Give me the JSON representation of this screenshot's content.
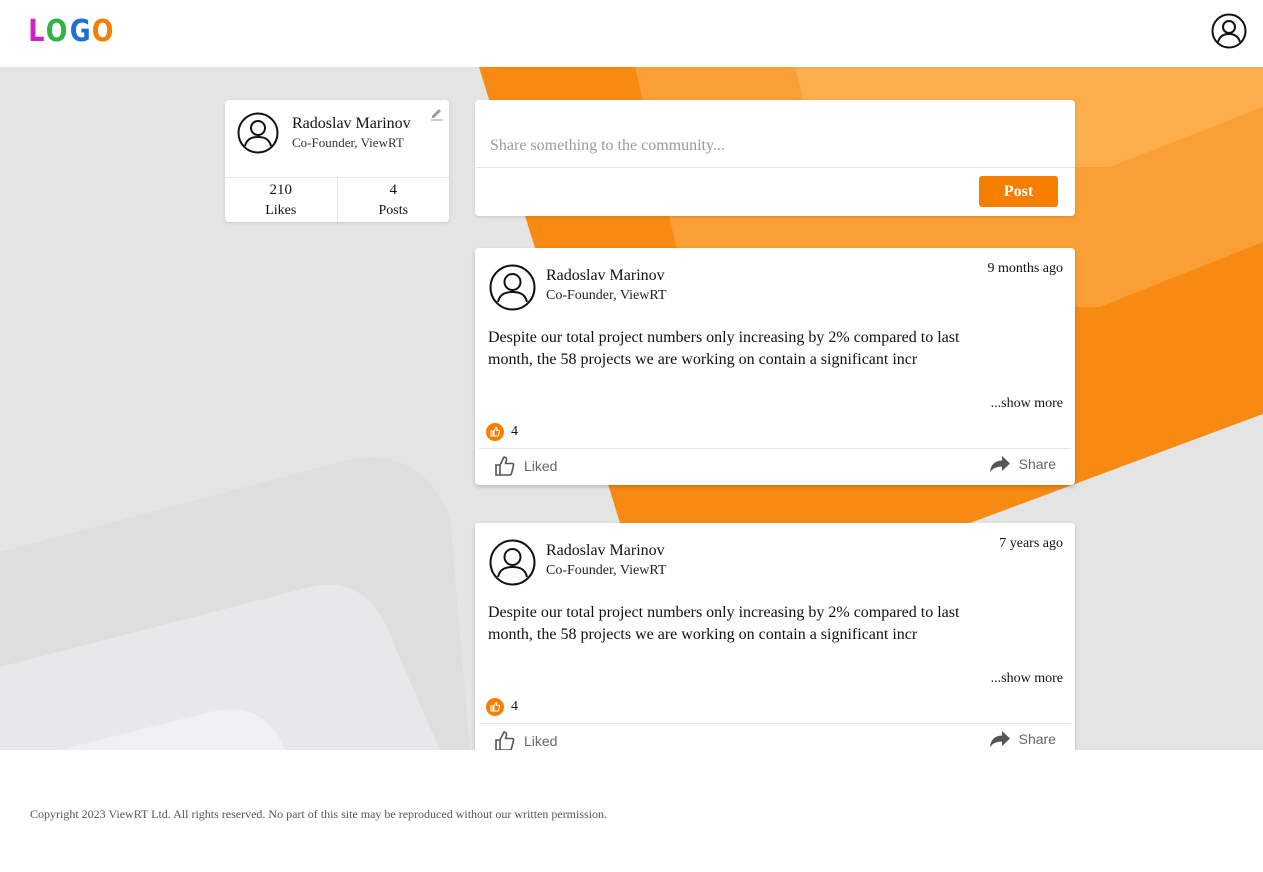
{
  "header": {
    "logo_letters": [
      "L",
      "O",
      "G",
      "O"
    ],
    "logo_colors": [
      "#d61ec8",
      "#2fb344",
      "#1f6fd6",
      "#f77f00"
    ],
    "user_icon": "user-circle-icon"
  },
  "profile": {
    "name": "Radoslav Marinov",
    "role": "Co-Founder, ViewRT",
    "edit_icon": "pencil-icon",
    "stats": [
      {
        "value": "210",
        "label": "Likes"
      },
      {
        "value": "4",
        "label": "Posts"
      }
    ]
  },
  "composer": {
    "placeholder": "Share something to the community...",
    "post_label": "Post"
  },
  "posts": [
    {
      "author": "Radoslav Marinov",
      "role": "Co-Founder, ViewRT",
      "time": "9 months ago",
      "body": "Despite our total project numbers only increasing by 2% compared to last month, the 58 projects we are working on contain a significant incr",
      "show_more": "...show more",
      "reaction_count": "4",
      "like_label": "Liked",
      "share_label": "Share"
    },
    {
      "author": "Radoslav Marinov",
      "role": "Co-Founder, ViewRT",
      "time": "7 years ago",
      "body": "Despite our total project numbers only increasing by 2% compared to last month, the 58 projects we are working on contain a significant incr",
      "show_more": "...show more",
      "reaction_count": "4",
      "like_label": "Liked",
      "share_label": "Share"
    }
  ],
  "footer": {
    "copyright": "Copyright 2023 ViewRT Ltd. All rights reserved. No part of this site may be reproduced without our written permission."
  },
  "colors": {
    "accent": "#f77f00",
    "background": "#e4e4e4"
  }
}
